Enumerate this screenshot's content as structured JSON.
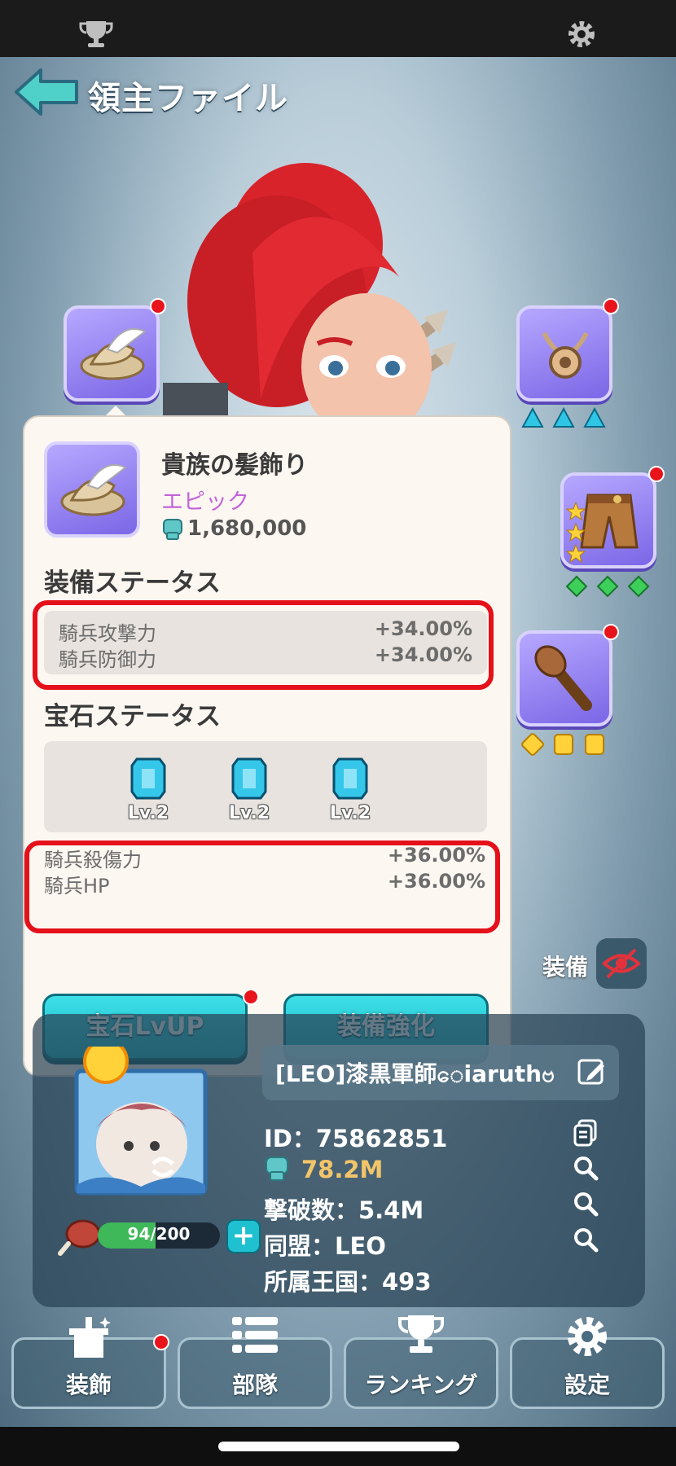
{
  "header": {
    "title": "領主ファイル"
  },
  "item": {
    "name": "貴族の髪飾り",
    "rarity": "エピック",
    "power": "1,680,000"
  },
  "equip_status": {
    "heading": "装備ステータス",
    "stats": [
      {
        "label": "騎兵攻撃力",
        "value": "+34.00%"
      },
      {
        "label": "騎兵防御力",
        "value": "+34.00%"
      }
    ]
  },
  "gem_status": {
    "heading": "宝石ステータス",
    "gems": [
      {
        "level": "Lv.2"
      },
      {
        "level": "Lv.2"
      },
      {
        "level": "Lv.2"
      }
    ],
    "stats": [
      {
        "label": "騎兵殺傷力",
        "value": "+36.00%"
      },
      {
        "label": "騎兵HP",
        "value": "+36.00%"
      }
    ]
  },
  "buttons": {
    "gem_lvup": "宝石LvUP",
    "enhance": "装備強化",
    "equip": "装備"
  },
  "profile": {
    "name": "[LEO]漆黒軍師ေiaruthဗ",
    "id": "ID：75862851",
    "power": "78.2M",
    "kills": "撃破数：5.4M",
    "alliance": "同盟：LEO",
    "kingdom": "所属王国：493",
    "stamina": "94/200",
    "stamina_fraction": 0.47
  },
  "nav": [
    {
      "label": "装飾"
    },
    {
      "label": "部隊"
    },
    {
      "label": "ランキング"
    },
    {
      "label": "設定"
    }
  ],
  "colors": {
    "accent": "#1ab5c4",
    "highlight_frame": "#e4101a",
    "rarity": "#c264d9",
    "power_gold": "#f3c56a"
  }
}
